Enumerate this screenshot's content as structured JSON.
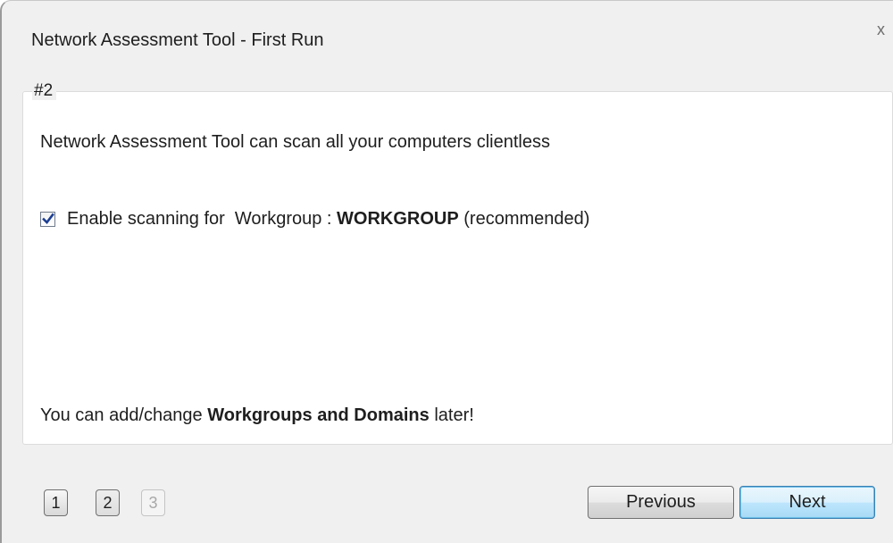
{
  "window": {
    "title": "Network Assessment Tool - First Run",
    "close_glyph": "x"
  },
  "step": {
    "legend": "#2",
    "description": "Network Assessment Tool can scan all your computers clientless",
    "checkbox": {
      "checked": true,
      "label_prefix": "Enable scanning for  Workgroup : ",
      "label_name": "WORKGROUP",
      "label_suffix": " (recommended)"
    },
    "footer_note": {
      "prefix": "You can add/change ",
      "bold": "Workgroups and Domains",
      "suffix": " later!"
    }
  },
  "pager": {
    "pages": [
      {
        "label": "1",
        "state": "enabled"
      },
      {
        "label": "2",
        "state": "current"
      },
      {
        "label": "3",
        "state": "disabled"
      }
    ]
  },
  "buttons": {
    "previous": "Previous",
    "next": "Next"
  },
  "colors": {
    "window_bg": "#f0f0f0",
    "panel_bg": "#ffffff",
    "default_button": "#bee6fd",
    "checkmark": "#1c3f94"
  }
}
